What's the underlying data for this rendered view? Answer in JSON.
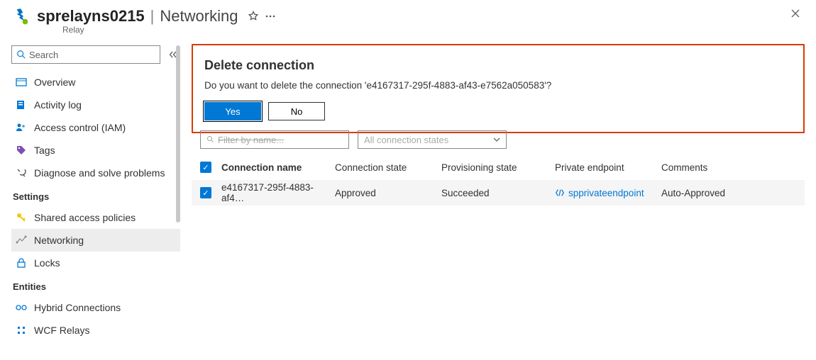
{
  "header": {
    "resource_name": "sprelayns0215",
    "section": "Networking",
    "resource_type": "Relay",
    "close_aria": "Close"
  },
  "sidebar": {
    "search_placeholder": "Search",
    "items_top": [
      {
        "label": "Overview"
      },
      {
        "label": "Activity log"
      },
      {
        "label": "Access control (IAM)"
      },
      {
        "label": "Tags"
      },
      {
        "label": "Diagnose and solve problems"
      }
    ],
    "group_settings": "Settings",
    "items_settings": [
      {
        "label": "Shared access policies"
      },
      {
        "label": "Networking"
      },
      {
        "label": "Locks"
      }
    ],
    "group_entities": "Entities",
    "items_entities": [
      {
        "label": "Hybrid Connections"
      },
      {
        "label": "WCF Relays"
      }
    ]
  },
  "dialog": {
    "title": "Delete connection",
    "message": "Do you want to delete the connection 'e4167317-295f-4883-af43-e7562a050583'?",
    "yes": "Yes",
    "no": "No"
  },
  "filters": {
    "name_placeholder": "Filter by name...",
    "state_placeholder": "All connection states"
  },
  "table": {
    "cols": {
      "name": "Connection name",
      "cstate": "Connection state",
      "pstate": "Provisioning state",
      "endpoint": "Private endpoint",
      "comments": "Comments"
    },
    "row": {
      "name": "e4167317-295f-4883-af4…",
      "cstate": "Approved",
      "pstate": "Succeeded",
      "endpoint": "spprivateendpoint",
      "comments": "Auto-Approved"
    }
  }
}
